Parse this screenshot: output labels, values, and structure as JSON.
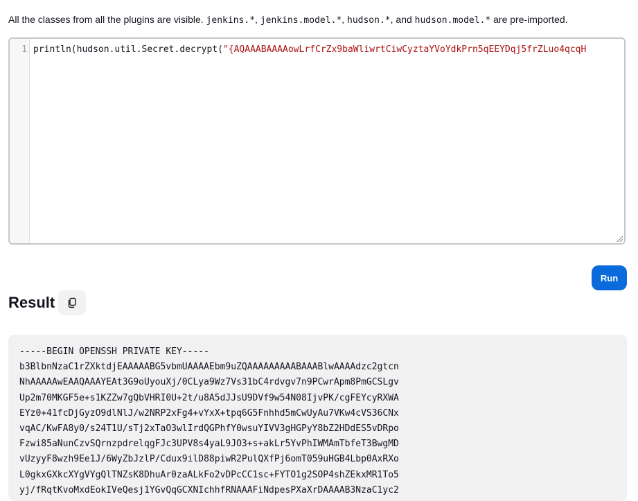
{
  "help": {
    "prefix": "All the classes from all the plugins are visible. ",
    "code1": "jenkins.*",
    "sep1": ", ",
    "code2": "jenkins.model.*",
    "sep2": ", ",
    "code3": "hudson.*",
    "sep3": ", and ",
    "code4": "hudson.model.*",
    "suffix": " are pre-imported."
  },
  "editor": {
    "line_number": "1",
    "code_prefix": "println(hudson.util.Secret.decrypt(",
    "code_string": "\"{AQAAABAAAAowLrfCrZx9baWliwrtCiwCyztaYVoYdkPrn5qEEYDqj5frZLuo4qcqH"
  },
  "run_button": {
    "label": "Run"
  },
  "result": {
    "title": "Result",
    "lines": [
      "-----BEGIN OPENSSH PRIVATE KEY-----",
      "b3BlbnNzaC1rZXktdjEAAAAABG5vbmUAAAAEbm9uZQAAAAAAAAABAAABlwAAAAdzc2gtcn",
      "NhAAAAAwEAAQAAAYEAt3G9oUyouXj/0CLya9Wz7Vs31bC4rdvgv7n9PCwrApm8PmGCSLgv",
      "Up2m70MKGF5e+s1KZZw7gQbVHRI0U+2t/u8A5dJJsU9DVf9w54N08IjvPK/cgFEYcyRXWA",
      "EYz0+41fcDjGyzO9dlNlJ/w2NRP2xFg4+vYxX+tpq6G5Fnhhd5mCwUyAu7VKw4cVS36CNx",
      "vqAC/KwFA8y0/s24T1U/sTj2xTaO3wlIrdQGPhfY0wsuYIVV3gHGPyY8bZ2HDdES5vDRpo",
      "Fzwi85aNunCzvSQrnzpdrelqgFJc3UPV8s4yaL9JO3+s+akLr5YvPhIWMAmTbfeT3BwgMD",
      "vUzyyF8wzh9Ee1J/6WyZbJzlP/Cdux9ilD88piwR2PulQXfPj6omT059uHGB4Lbp0AxRXo",
      "L0gkxGXkcXYgVYgQlTNZsK8DhuAr0zaALkFo2vDPcCC1sc+FYTO1g2SOP4shZEkxMR1To5",
      "yj/fRqtKvoMxdEokIVeQesj1YGvQqGCXNIchhfRNAAAFiNdpesPXaXrDAAAAB3NzaC1yc2"
    ]
  }
}
